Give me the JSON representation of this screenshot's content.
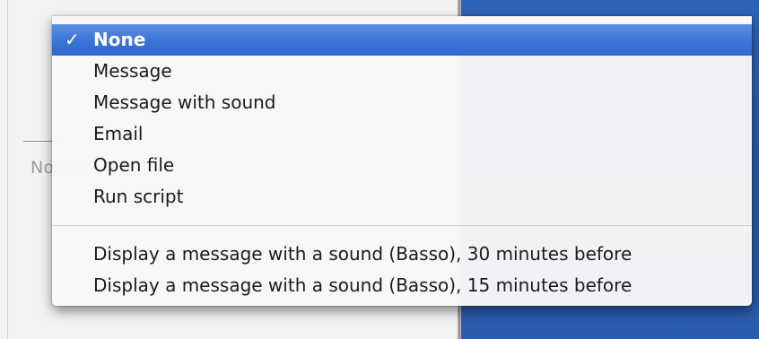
{
  "background": {
    "notes_label": "Notes:"
  },
  "menu": {
    "selected_check": "✓",
    "items": [
      {
        "label": "None",
        "selected": true
      },
      {
        "label": "Message",
        "selected": false
      },
      {
        "label": "Message with sound",
        "selected": false
      },
      {
        "label": "Email",
        "selected": false
      },
      {
        "label": "Open file",
        "selected": false
      },
      {
        "label": "Run script",
        "selected": false
      }
    ],
    "recent_items": [
      {
        "label": "Display a message with a sound (Basso), 30 minutes before"
      },
      {
        "label": "Display a message with a sound (Basso), 15 minutes before"
      }
    ]
  },
  "colors": {
    "selection": "#3a74d6",
    "desktop_blue": "#2b5cad",
    "menu_background": "#f7f7f7"
  }
}
